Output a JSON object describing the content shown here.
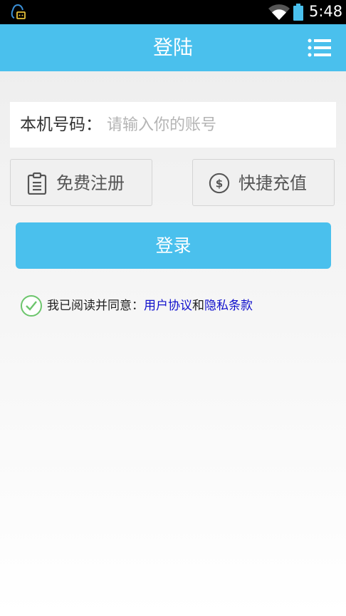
{
  "status_bar": {
    "time": "5:48",
    "icons": [
      "notification-icon",
      "wifi-icon",
      "battery-icon"
    ]
  },
  "title_bar": {
    "title": "登陆",
    "menu_icon": "menu-icon"
  },
  "phone_field": {
    "label": "本机号码：",
    "placeholder": "请输入你的账号",
    "value": ""
  },
  "actions": {
    "register": {
      "label": "免费注册",
      "icon": "clipboard-icon"
    },
    "recharge": {
      "label": "快捷充值",
      "icon": "dollar-icon"
    }
  },
  "login_button": {
    "label": "登录"
  },
  "agreement": {
    "prefix": "我已阅读并同意：",
    "user_agreement": "用户协议",
    "conjunction": "和",
    "privacy_policy": "隐私条款",
    "checked": true
  },
  "colors": {
    "accent": "#4ac0ed",
    "link": "#1010cc",
    "check": "#6cc56c"
  }
}
